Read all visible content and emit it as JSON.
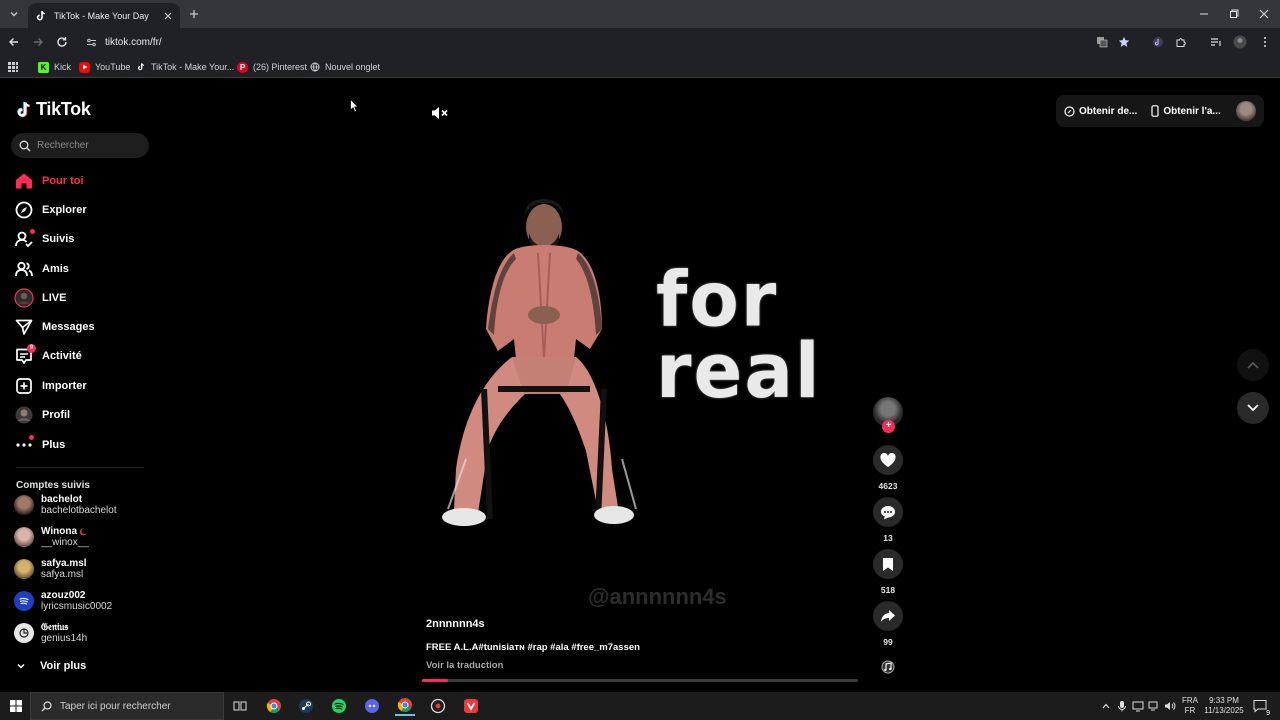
{
  "browser": {
    "tab_title": "TikTok - Make Your Day",
    "url": "tiktok.com/fr/",
    "bookmarks": [
      "Kick",
      "YouTube",
      "TikTok - Make Your...",
      "(26) Pinterest",
      "Nouvel onglet"
    ]
  },
  "tiktok": {
    "logo_text": "TikTok",
    "search_placeholder": "Rechercher",
    "nav": [
      {
        "label": "Pour toi",
        "icon": "home-icon",
        "active": true
      },
      {
        "label": "Explorer",
        "icon": "compass-icon"
      },
      {
        "label": "Suivis",
        "icon": "following-icon"
      },
      {
        "label": "Amis",
        "icon": "friends-icon"
      },
      {
        "label": "LIVE",
        "icon": "live-icon"
      },
      {
        "label": "Messages",
        "icon": "messages-icon"
      },
      {
        "label": "Activité",
        "icon": "activity-icon",
        "badge": "9"
      },
      {
        "label": "Importer",
        "icon": "upload-icon"
      },
      {
        "label": "Profil",
        "icon": "profile-icon"
      },
      {
        "label": "Plus",
        "icon": "more-icon"
      }
    ],
    "followed_title": "Comptes suivis",
    "followed": [
      {
        "name": "bachelot",
        "handle": "bachelotbachelot"
      },
      {
        "name": "Winona",
        "handle": "__winox__"
      },
      {
        "name": "safya.msl",
        "handle": "safya.msl"
      },
      {
        "name": "azouz002",
        "handle": "lyricsmusic0002"
      },
      {
        "name": "𝔊𝔢𝔫𝔦𝔲𝔰",
        "handle": "genius14h"
      }
    ],
    "see_more": "Voir plus",
    "top_right": {
      "get_coins": "Obtenir de...",
      "get_app": "Obtenir l'a..."
    }
  },
  "video": {
    "overlay_text_line1": "for",
    "overlay_text_line2": "real",
    "watermark": "@annnnnn4s",
    "author": "2nnnnnn4s",
    "caption": "FREE A.L.A#tunisiaᴛɴ #rap #ala #free_m7assen",
    "translate": "Voir la traduction",
    "progress": 0.06,
    "likes": "4623",
    "comments": "13",
    "saves": "518",
    "shares": "99"
  },
  "taskbar": {
    "search_placeholder": "Taper ici pour rechercher",
    "lang_top": "FRA",
    "lang_bottom": "FR",
    "time": "9:33 PM",
    "date": "11/13/2025",
    "notif_count": "9"
  },
  "colors": {
    "accent": "#fe2c55",
    "bg": "#000000"
  }
}
